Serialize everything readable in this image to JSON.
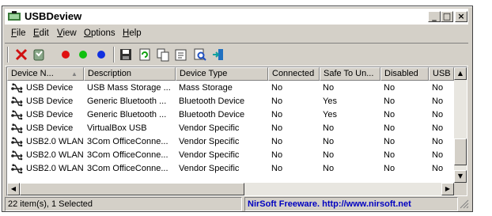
{
  "window": {
    "title": "USBDeview",
    "controls": {
      "minimize": "_",
      "maximize": "□",
      "close": "×"
    }
  },
  "menu": [
    {
      "label": "File",
      "accel": "F",
      "rest": "ile"
    },
    {
      "label": "Edit",
      "accel": "E",
      "rest": "dit"
    },
    {
      "label": "View",
      "accel": "V",
      "rest": "iew"
    },
    {
      "label": "Options",
      "accel": "O",
      "rest": "ptions"
    },
    {
      "label": "Help",
      "accel": "H",
      "rest": "elp"
    }
  ],
  "toolbar": {
    "icons": [
      "uninstall-icon",
      "properties-wizard-icon",
      "red-dot-icon",
      "green-dot-icon",
      "blue-dot-icon",
      "save-icon",
      "refresh-icon",
      "copy-icon",
      "properties-icon",
      "find-icon",
      "exit-icon"
    ]
  },
  "table": {
    "columns": [
      "Device N...",
      "Description",
      "Device Type",
      "Connected",
      "Safe To Un...",
      "Disabled",
      "USB H"
    ],
    "sort_indicator": "▲",
    "rows": [
      [
        "USB Device",
        "USB Mass Storage ...",
        "Mass Storage",
        "No",
        "No",
        "No",
        "No"
      ],
      [
        "USB Device",
        "Generic Bluetooth ...",
        "Bluetooth Device",
        "No",
        "Yes",
        "No",
        "No"
      ],
      [
        "USB Device",
        "Generic Bluetooth ...",
        "Bluetooth Device",
        "No",
        "Yes",
        "No",
        "No"
      ],
      [
        "USB Device",
        "VirtualBox USB",
        "Vendor Specific",
        "No",
        "No",
        "No",
        "No"
      ],
      [
        "USB2.0 WLAN",
        "3Com OfficeConne...",
        "Vendor Specific",
        "No",
        "No",
        "No",
        "No"
      ],
      [
        "USB2.0 WLAN",
        "3Com OfficeConne...",
        "Vendor Specific",
        "No",
        "No",
        "No",
        "No"
      ],
      [
        "USB2.0 WLAN",
        "3Com OfficeConne...",
        "Vendor Specific",
        "No",
        "No",
        "No",
        "No"
      ]
    ]
  },
  "status": {
    "count": "22 item(s), 1 Selected",
    "credit": "NirSoft Freeware.  http://www.nirsoft.net"
  },
  "colors": {
    "face": "#d4d0c8",
    "title_text": "#000000",
    "link": "#0000c0"
  }
}
